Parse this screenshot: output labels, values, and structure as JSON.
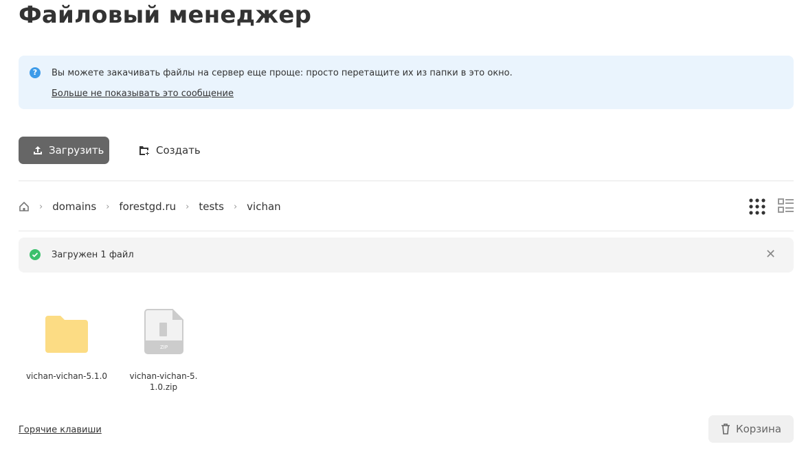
{
  "title": "Файловый менеджер",
  "info": {
    "text": "Вы можете закачивать файлы на сервер еще проще: просто перетащите их из папки в это окно.",
    "dismiss": "Больше не показывать это сообщение"
  },
  "toolbar": {
    "upload": "Загрузить",
    "create": "Создать"
  },
  "breadcrumb": [
    "domains",
    "forestgd.ru",
    "tests",
    "vichan"
  ],
  "notice": {
    "text": "Загружен 1 файл"
  },
  "files": [
    {
      "name": "vichan-vichan-5.1.0",
      "type": "folder"
    },
    {
      "name": "vichan-vichan-5.1.0.zip",
      "type": "zip",
      "badge": "ZIP"
    }
  ],
  "footer": {
    "hotkeys": "Горячие клавиши",
    "trash": "Корзина"
  }
}
